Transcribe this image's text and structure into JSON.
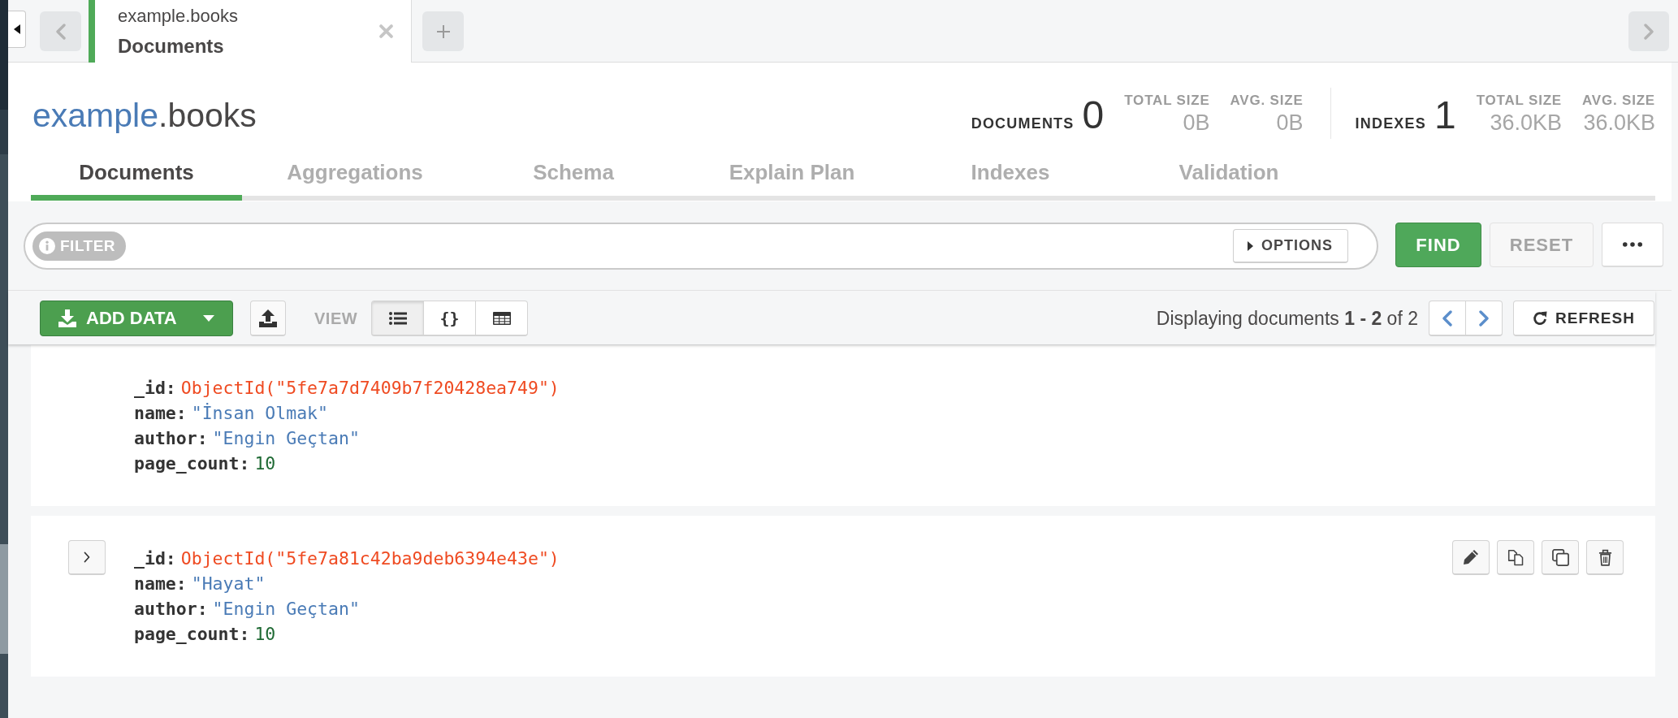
{
  "tab_bar": {
    "tabs": [
      {
        "namespace": "example.books",
        "title": "Documents",
        "selected": true
      }
    ]
  },
  "header": {
    "database": "example",
    "collection": ".books",
    "stats": [
      {
        "label": "DOCUMENTS",
        "count": "0",
        "metrics": [
          {
            "label": "TOTAL SIZE",
            "value": "0B"
          },
          {
            "label": "AVG. SIZE",
            "value": "0B"
          }
        ]
      },
      {
        "label": "INDEXES",
        "count": "1",
        "metrics": [
          {
            "label": "TOTAL SIZE",
            "value": "36.0KB"
          },
          {
            "label": "AVG. SIZE",
            "value": "36.0KB"
          }
        ]
      }
    ],
    "tabs": [
      {
        "label": "Documents",
        "selected": true
      },
      {
        "label": "Aggregations",
        "selected": false
      },
      {
        "label": "Schema",
        "selected": false
      },
      {
        "label": "Explain Plan",
        "selected": false
      },
      {
        "label": "Indexes",
        "selected": false
      },
      {
        "label": "Validation",
        "selected": false
      }
    ]
  },
  "query_bar": {
    "filter_label": "FILTER",
    "options_label": "OPTIONS",
    "buttons": [
      {
        "label": "FIND",
        "kind": "primary",
        "disabled": false
      },
      {
        "label": "RESET",
        "kind": "secondary",
        "disabled": true
      }
    ]
  },
  "toolbar": {
    "add_data_label": "ADD DATA",
    "view_label": "VIEW",
    "views": [
      {
        "kind": "list",
        "selected": true
      },
      {
        "kind": "json",
        "label": "{}",
        "selected": false
      },
      {
        "kind": "table",
        "selected": false
      }
    ],
    "summary": "Displaying documents **1 - 2** of 2",
    "refresh_label": "REFRESH"
  },
  "documents": [
    {
      "hovered": false,
      "fields": [
        {
          "key": "_id:",
          "value": "ObjectId(\"5fe7a7d7409b7f20428ea749\")",
          "kind": "objectid"
        },
        {
          "key": "name:",
          "value": "\"İnsan Olmak\"",
          "kind": "string"
        },
        {
          "key": "author:",
          "value": "\"Engin Geçtan\"",
          "kind": "string"
        },
        {
          "key": "page_count:",
          "value": "10",
          "kind": "number"
        }
      ]
    },
    {
      "hovered": true,
      "fields": [
        {
          "key": "_id:",
          "value": "ObjectId(\"5fe7a81c42ba9deb6394e43e\")",
          "kind": "objectid"
        },
        {
          "key": "name:",
          "value": "\"Hayat\"",
          "kind": "string"
        },
        {
          "key": "author:",
          "value": "\"Engin Geçtan\"",
          "kind": "string"
        },
        {
          "key": "page_count:",
          "value": "10",
          "kind": "number"
        }
      ]
    }
  ]
}
